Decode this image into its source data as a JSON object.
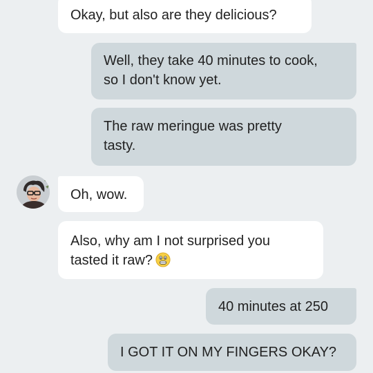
{
  "messages": [
    {
      "direction": "incoming",
      "text": "Okay, but also are they delicious?"
    },
    {
      "direction": "outgoing",
      "line1": "Well, they take 40 minutes to cook,",
      "line2": "so I don't know yet."
    },
    {
      "direction": "outgoing",
      "line1": "The raw meringue was pretty",
      "line2": "tasty."
    },
    {
      "direction": "incoming",
      "text": "Oh, wow."
    },
    {
      "direction": "incoming",
      "line1": "Also, why am I not surprised you",
      "line2": "tasted it raw?",
      "emoji": "grimacing-face-emoji"
    },
    {
      "direction": "outgoing",
      "text": "40 minutes at 250"
    },
    {
      "direction": "outgoing",
      "text": "I GOT IT ON MY FINGERS OKAY?"
    }
  ],
  "avatar": {
    "icon": "contact-avatar-photo"
  },
  "colors": {
    "background": "#eceff1",
    "incoming_bubble": "#ffffff",
    "outgoing_bubble": "#cfd8dc",
    "text": "#222222"
  }
}
